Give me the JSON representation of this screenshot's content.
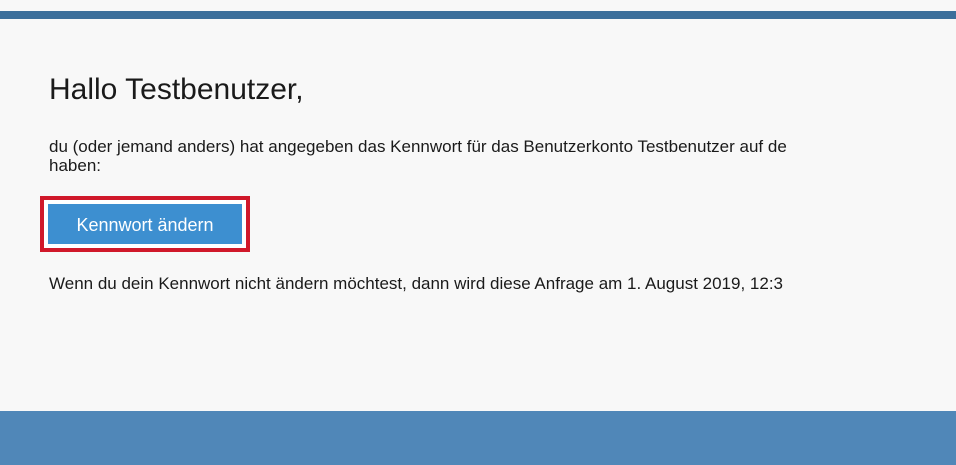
{
  "email": {
    "greeting": "Hallo Testbenutzer,",
    "intro_line1": "du (oder jemand anders) hat angegeben das Kennwort für das Benutzerkonto Testbenutzer auf de",
    "intro_line2": "haben:",
    "button_label": "Kennwort ändern",
    "note": "Wenn du dein Kennwort nicht ändern möchtest, dann wird diese Anfrage am 1. August 2019, 12:3"
  },
  "colors": {
    "top_bar": "#3c6f9b",
    "button": "#3d8fd0",
    "highlight": "#d0182a",
    "bottom_bar": "#5087b8"
  }
}
